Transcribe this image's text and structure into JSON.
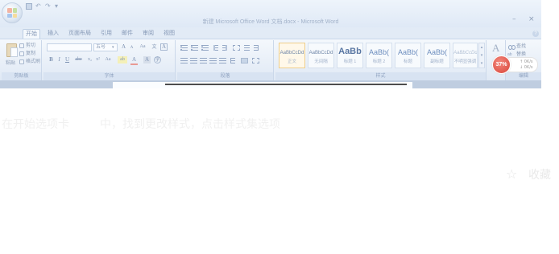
{
  "window": {
    "title": "新建 Microsoft Office Word 文档.docx - Microsoft Word",
    "minimize": "–",
    "close": "×"
  },
  "quick_access": {
    "icons": [
      "save-icon",
      "undo-icon",
      "redo-icon",
      "customize-icon"
    ],
    "undo": "↶",
    "redo": "↷",
    "customize": "▾"
  },
  "tabs": [
    {
      "label": "开始",
      "active": true
    },
    {
      "label": "插入"
    },
    {
      "label": "页面布局"
    },
    {
      "label": "引用"
    },
    {
      "label": "邮件"
    },
    {
      "label": "审阅"
    },
    {
      "label": "视图"
    }
  ],
  "help": "?",
  "clipboard": {
    "paste": "粘贴",
    "cut": "剪切",
    "copy": "复制",
    "format_painter": "格式刷",
    "group_label": "剪贴板"
  },
  "font": {
    "size": "五号",
    "dropdown": "▾",
    "grow": "A",
    "shrink": "A",
    "change_case": "Aa",
    "phonetic": "文",
    "char_border": "A",
    "bold": "B",
    "italic": "I",
    "underline": "U",
    "strike": "abe",
    "subscript": "x₂",
    "superscript": "x²",
    "highlight": "ab",
    "font_color": "A",
    "char_shading": "A",
    "enclose": "字",
    "group_label": "字体"
  },
  "paragraph": {
    "icons": [
      "bullets-icon",
      "numbering-icon",
      "multilevel-list-icon",
      "decrease-indent-icon",
      "increase-indent-icon",
      "chinese-layout-icon",
      "sort-icon",
      "show-marks-icon",
      "align-left-icon",
      "align-center-icon",
      "align-right-icon",
      "justify-icon",
      "distributed-icon",
      "line-spacing-icon",
      "shading-icon",
      "borders-icon"
    ],
    "group_label": "段落"
  },
  "styles": {
    "items": [
      {
        "preview": "AaBbCcDd",
        "name": "正文",
        "selected": true
      },
      {
        "preview": "AaBbCcDd",
        "name": "无间隔"
      },
      {
        "preview": "AaBb",
        "name": "标题 1"
      },
      {
        "preview": "AaBb(",
        "name": "标题 2"
      },
      {
        "preview": "AaBb(",
        "name": "标题"
      },
      {
        "preview": "AaBb(",
        "name": "副标题"
      },
      {
        "preview": "AaBbCcDd",
        "name": "不明显强调"
      }
    ],
    "scroll_up": "▴",
    "scroll_down": "▾",
    "more": "▾",
    "group_label": "样式"
  },
  "change_styles": {
    "icon_glyph": "A"
  },
  "editing": {
    "find": "查找",
    "replace_icon": "ab",
    "replace": "替换",
    "group_label": "编辑"
  },
  "speed_ball": {
    "percent": "37%",
    "upload": "↑ 0K/s",
    "download": "↓ 0K/s"
  },
  "article": {
    "caption_lead": "在开始选项卡",
    "caption_rest": "中，找到更改样式，点击样式集选项",
    "favorite_icon": "☆",
    "favorite": "收藏"
  },
  "colors": {
    "ribbon_bg": "#e2ebf6",
    "ribbon_text": "#8a9bb5",
    "speed_ball": "#d8453a",
    "selected_style_border": "#efce8a"
  }
}
